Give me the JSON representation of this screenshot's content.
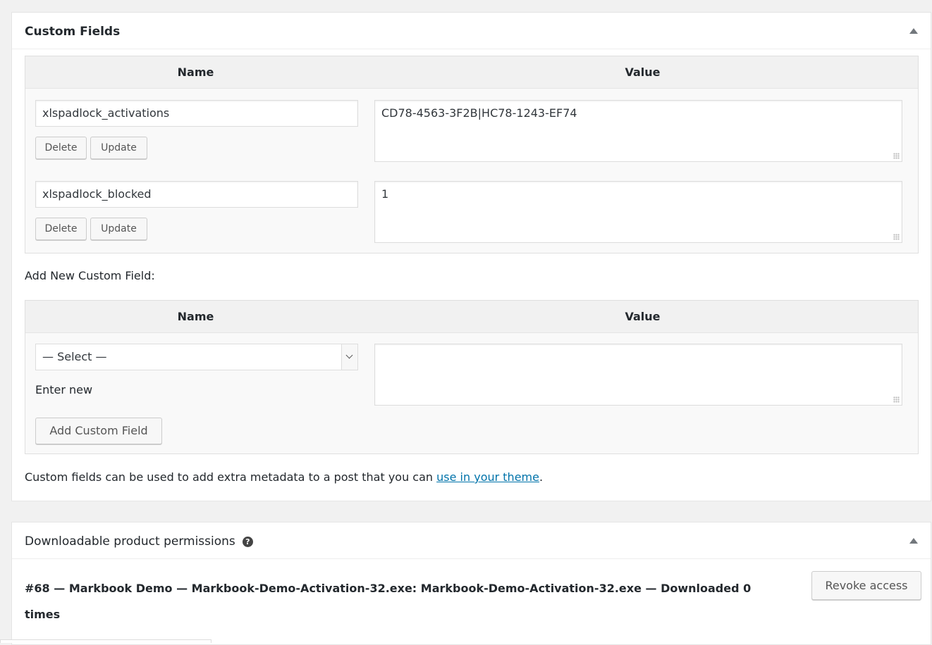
{
  "custom_fields": {
    "title": "Custom Fields",
    "toggle_icon": "triangle-up",
    "col_name": "Name",
    "col_value": "Value",
    "rows": [
      {
        "name": "xlspadlock_activations",
        "value": "CD78-4563-3F2B|HC78-1243-EF74"
      },
      {
        "name": "xlspadlock_blocked",
        "value": "1"
      }
    ],
    "delete_label": "Delete",
    "update_label": "Update",
    "add_new_heading": "Add New Custom Field:",
    "select_value": "— Select —",
    "enter_new_label": "Enter new",
    "add_button_label": "Add Custom Field",
    "help_prefix": "Custom fields can be used to add extra metadata to a post that you can ",
    "help_link": "use in your theme",
    "help_suffix": "."
  },
  "downloads": {
    "title": "Downloadable product permissions",
    "help_icon": "?",
    "permission_text": "#68 — Markbook Demo — Markbook-Demo-Activation-32.exe: Markbook-Demo-Activation-32.exe — Downloaded 0 times",
    "revoke_label": "Revoke access"
  }
}
